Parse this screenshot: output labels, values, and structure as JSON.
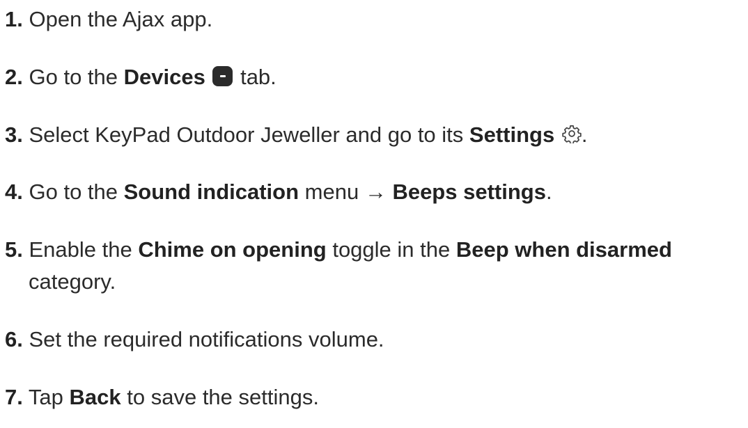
{
  "steps": [
    {
      "num": "1.",
      "t1": "Open the Ajax app."
    },
    {
      "num": "2.",
      "t1": "Go to the ",
      "b1": "Devices",
      "t2": " tab.",
      "icon": "devices-icon"
    },
    {
      "num": "3.",
      "t1": "Select KeyPad Outdoor Jeweller and go to its ",
      "b1": "Settings",
      "t2": ".",
      "icon": "gear-icon"
    },
    {
      "num": "4.",
      "t1": "Go to the ",
      "b1": "Sound indication",
      "t2": " menu → ",
      "b2": "Beeps settings",
      "t3": "."
    },
    {
      "num": "5.",
      "t1": "Enable the ",
      "b1": "Chime on opening",
      "t2": " toggle in the ",
      "b2": "Beep when disarmed",
      "t3": "category."
    },
    {
      "num": "6.",
      "t1": "Set the required notifications volume."
    },
    {
      "num": "7.",
      "t1": "Tap ",
      "b1": "Back",
      "t2": " to save the settings."
    }
  ]
}
